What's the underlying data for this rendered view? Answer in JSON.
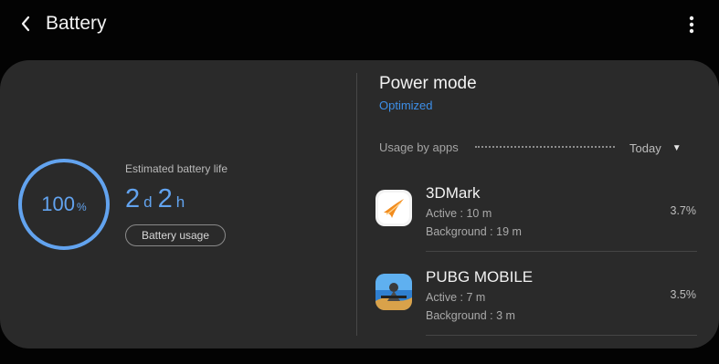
{
  "header": {
    "title": "Battery",
    "back_icon": "back-arrow-icon",
    "more_icon": "more-vert-icon"
  },
  "battery": {
    "percent_value": "100",
    "percent_unit": "%",
    "level": 1.0,
    "estimated_label": "Estimated battery life",
    "days_value": "2",
    "days_unit": "d",
    "hours_value": "2",
    "hours_unit": "h",
    "usage_button_label": "Battery usage"
  },
  "power_mode": {
    "title": "Power mode",
    "value": "Optimized"
  },
  "usage": {
    "label": "Usage by apps",
    "period": "Today",
    "period_icon": "dropdown-caret-icon"
  },
  "apps": [
    {
      "name": "3DMark",
      "active": "Active : 10 m",
      "background": "Background : 19 m",
      "percent": "3.7%",
      "icon": "3dmark-app-icon"
    },
    {
      "name": "PUBG MOBILE",
      "active": "Active : 7 m",
      "background": "Background : 3 m",
      "percent": "3.5%",
      "icon": "pubg-mobile-app-icon"
    }
  ],
  "colors": {
    "accent": "#3d8fe8",
    "ring": "#62a3ef",
    "card": "#2a2a2a",
    "background": "#030303"
  }
}
